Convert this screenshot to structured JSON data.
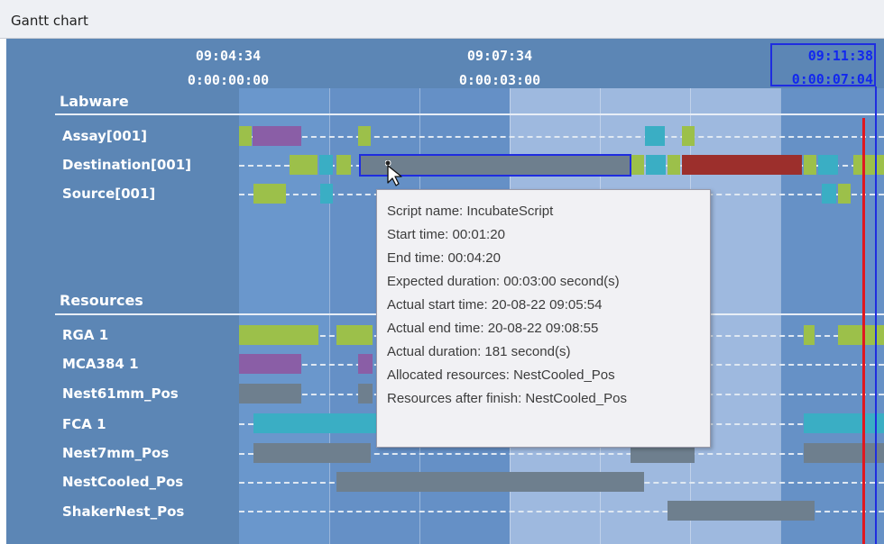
{
  "window": {
    "title": "Gantt chart"
  },
  "header": {
    "times": [
      {
        "clock": "09:04:34",
        "elapsed": "0:00:00:00"
      },
      {
        "clock": "09:07:34",
        "elapsed": "0:00:03:00"
      }
    ],
    "cursor": {
      "clock": "09:11:38",
      "elapsed": "0:00:07:04"
    }
  },
  "labware": {
    "heading": "Labware",
    "rows": [
      "Assay[001]",
      "Destination[001]",
      "Source[001]"
    ]
  },
  "resources": {
    "heading": "Resources",
    "rows": [
      "RGA 1",
      "MCA384 1",
      "Nest61mm_Pos",
      "FCA 1",
      "Nest7mm_Pos",
      "NestCooled_Pos",
      "ShakerNest_Pos"
    ]
  },
  "tooltip": {
    "lines": [
      "Script name: IncubateScript",
      "Start time: 00:01:20",
      "End time: 00:04:20",
      "Expected duration: 00:03:00 second(s)",
      "Actual start time: 20-08-22 09:05:54",
      "Actual end time: 20-08-22 09:08:55",
      "Actual duration: 181 second(s)",
      "Allocated resources: NestCooled_Pos",
      "Resources after finish: NestCooled_Pos"
    ]
  },
  "colors": {
    "green": "#9cc04a",
    "purple": "#8a5ea6",
    "teal": "#3aaec4",
    "gray": "#6e7f8e",
    "darkred": "#9c2f2c",
    "cursor_blue": "#1f2de0",
    "now_red": "#e01820"
  }
}
